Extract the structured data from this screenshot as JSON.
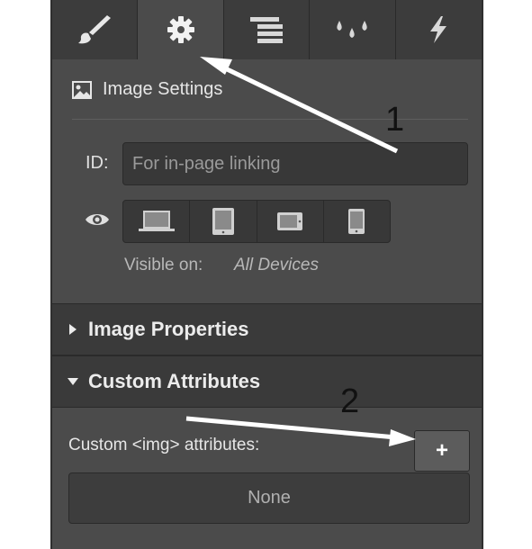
{
  "tabs": [
    {
      "icon": "paintbrush-icon",
      "active": false
    },
    {
      "icon": "gear-icon",
      "active": true
    },
    {
      "icon": "align-lines-icon",
      "active": false
    },
    {
      "icon": "droplets-icon",
      "active": false
    },
    {
      "icon": "lightning-icon",
      "active": false
    }
  ],
  "image_settings": {
    "title": "Image Settings",
    "id_label": "ID:",
    "id_placeholder": "For in-page linking",
    "visible_label": "Visible on:",
    "visible_value": "All Devices",
    "devices": [
      "laptop-icon",
      "tablet-icon",
      "tablet-landscape-icon",
      "phone-icon"
    ]
  },
  "sections": {
    "image_properties": "Image Properties",
    "custom_attributes": "Custom Attributes"
  },
  "custom_attributes": {
    "label": "Custom <img> attributes:",
    "add_label": "+",
    "empty_text": "None"
  },
  "annotations": {
    "marker1": "1",
    "marker2": "2"
  },
  "colors": {
    "panel_bg": "#4b4b4b",
    "tabbar_bg": "#3c3c3c",
    "section_bg": "#3a3a3a",
    "arrow": "#ffffff"
  }
}
